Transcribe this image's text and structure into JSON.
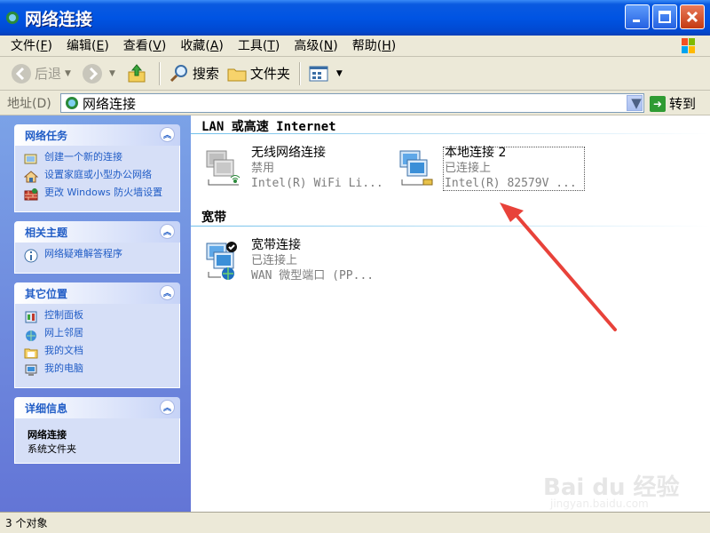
{
  "window": {
    "title": "网络连接"
  },
  "menu": [
    {
      "label": "文件",
      "key": "F"
    },
    {
      "label": "编辑",
      "key": "E"
    },
    {
      "label": "查看",
      "key": "V"
    },
    {
      "label": "收藏",
      "key": "A"
    },
    {
      "label": "工具",
      "key": "T"
    },
    {
      "label": "高级",
      "key": "N"
    },
    {
      "label": "帮助",
      "key": "H"
    }
  ],
  "toolbar": {
    "back": "后退",
    "search": "搜索",
    "folders": "文件夹"
  },
  "address": {
    "label": "地址(D)",
    "value": "网络连接",
    "go": "转到"
  },
  "sidebar": {
    "network_tasks": {
      "title": "网络任务",
      "items": [
        "创建一个新的连接",
        "设置家庭或小型办公网络",
        "更改 Windows 防火墙设置"
      ]
    },
    "related": {
      "title": "相关主题",
      "items": [
        "网络疑难解答程序"
      ]
    },
    "other_places": {
      "title": "其它位置",
      "items": [
        "控制面板",
        "网上邻居",
        "我的文档",
        "我的电脑"
      ]
    },
    "details": {
      "title": "详细信息",
      "name": "网络连接",
      "type": "系统文件夹"
    }
  },
  "groups": {
    "lan": "LAN 或高速 Internet",
    "broadband": "宽带"
  },
  "connections": {
    "wireless": {
      "name": "无线网络连接",
      "status": "禁用",
      "device": "Intel(R) WiFi Li..."
    },
    "local": {
      "name": "本地连接 2",
      "status": "已连接上",
      "device": "Intel(R) 82579V ..."
    },
    "broadband": {
      "name": "宽带连接",
      "status": "已连接上",
      "device": "WAN 微型端口 (PP..."
    }
  },
  "status": {
    "text": "3 个对象"
  },
  "watermark": {
    "brand": "Bai du 经验",
    "url": "jingyan.baidu.com"
  },
  "colors": {
    "xp_blue": "#0054e3",
    "link": "#215dc6",
    "arrow": "#e8423a"
  }
}
